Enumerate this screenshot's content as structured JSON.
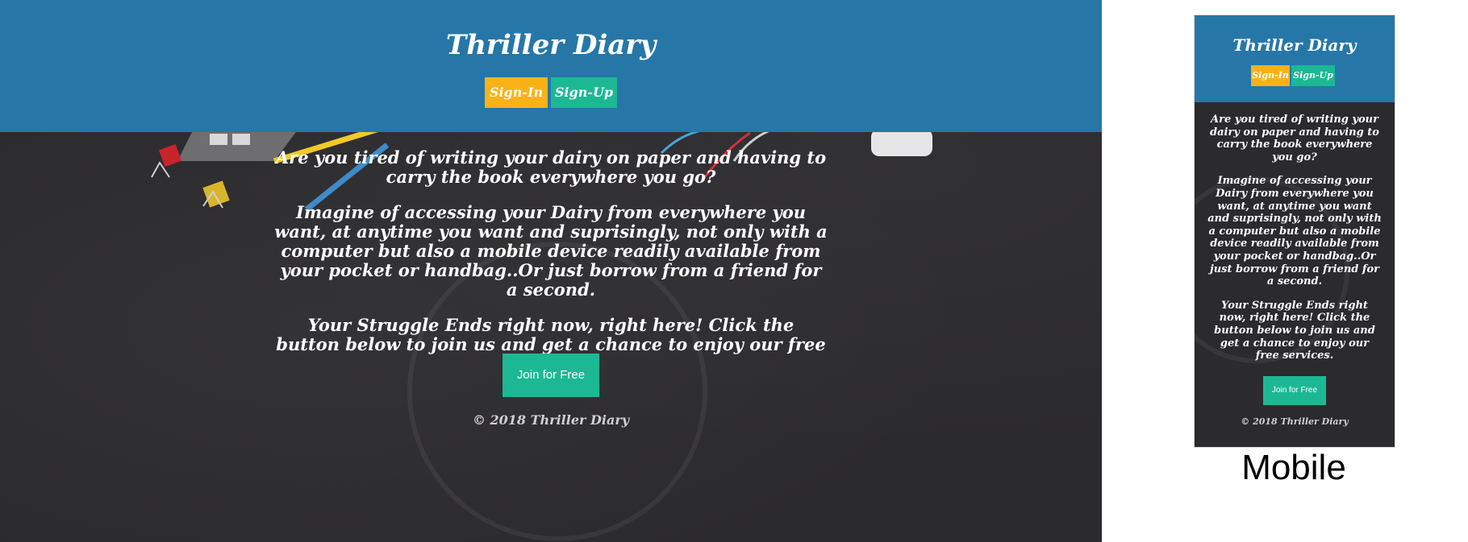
{
  "site": {
    "title": "Thriller Diary",
    "signin_label": "Sign-In",
    "signup_label": "Sign-Up"
  },
  "content": {
    "paragraph1": "Are you tired of writing your dairy on paper and having to carry the book everywhere you go?",
    "paragraph2": "Imagine of accessing your Dairy from everywhere you want, at anytime you want and suprisingly, not only with a computer but also a mobile device readily available from your pocket or handbag..Or just borrow from a friend for a second.",
    "paragraph3": "Your Struggle Ends right now, right here! Click the button below to join us and get a chance to enjoy our free services.",
    "join_label": "Join for Free",
    "copyright": "© 2018 Thriller Diary"
  },
  "caption": "Mobile",
  "colors": {
    "header": "#2677a8",
    "signin": "#f8b218",
    "signup": "#1cb894",
    "background": "#2b2a2d"
  }
}
